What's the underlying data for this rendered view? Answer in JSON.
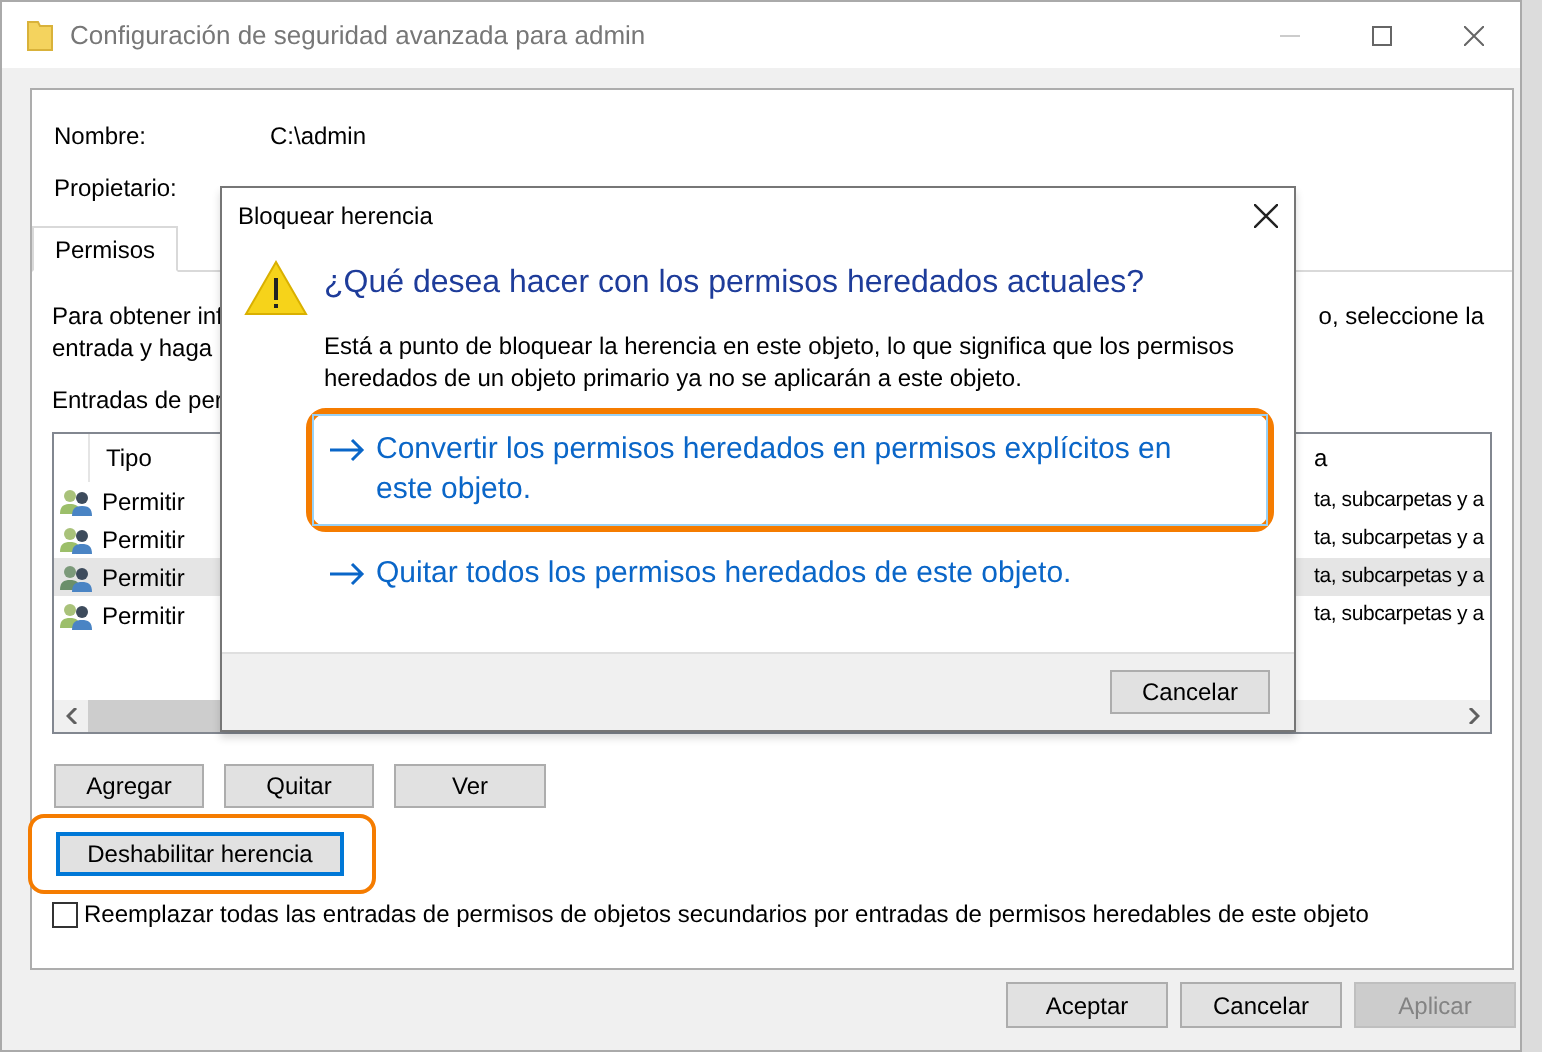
{
  "window": {
    "title": "Configuración de seguridad avanzada para admin"
  },
  "fields": [
    {
      "label": "Nombre:",
      "value": "C:\\admin"
    },
    {
      "label": "Propietario:"
    }
  ],
  "tabs": [
    {
      "label": "Permisos",
      "selected": true
    }
  ],
  "instructions": {
    "lines": [
      {
        "left": "Para obtener inf",
        "right": "o, seleccione la"
      },
      {
        "left": "entrada y haga"
      }
    ]
  },
  "entries_label": "Entradas de per",
  "table": {
    "columns": [
      "Tipo",
      "a"
    ],
    "rows": [
      {
        "type": "Permitir",
        "column_2": "ta, subcarpetas y a",
        "selected": false
      },
      {
        "type": "Permitir",
        "column_2": "ta, subcarpetas y a",
        "selected": false
      },
      {
        "type": "Permitir",
        "column_2": "ta, subcarpetas y a",
        "selected": true
      },
      {
        "type": "Permitir",
        "column_2": "ta, subcarpetas y a",
        "selected": false
      }
    ]
  },
  "entry_buttons": [
    "Agregar",
    "Quitar",
    "Ver"
  ],
  "disable_inheritance": {
    "label": "Deshabilitar herencia",
    "focused": true,
    "highlighted": true
  },
  "replace_checkbox": {
    "label": "Reemplazar todas las entradas de permisos de objetos secundarios por entradas de permisos heredables de este objeto",
    "checked": false
  },
  "footer_buttons": [
    {
      "label": "Aceptar",
      "disabled": false
    },
    {
      "label": "Cancelar",
      "disabled": false
    },
    {
      "label": "Aplicar",
      "disabled": true
    }
  ],
  "dialog": {
    "title": "Bloquear herencia",
    "heading": "¿Qué desea hacer con los permisos heredados actuales?",
    "message": "Está a punto de bloquear la herencia en este objeto, lo que significa que los permisos heredados de un objeto primario ya no se aplicarán a este objeto.",
    "options": [
      {
        "label": "Convertir los permisos heredados en permisos explícitos en este objeto.",
        "focused": true,
        "highlighted": true
      },
      {
        "label": "Quitar todos los permisos heredados de este objeto.",
        "focused": false,
        "highlighted": false
      }
    ],
    "cancel": "Cancelar"
  }
}
